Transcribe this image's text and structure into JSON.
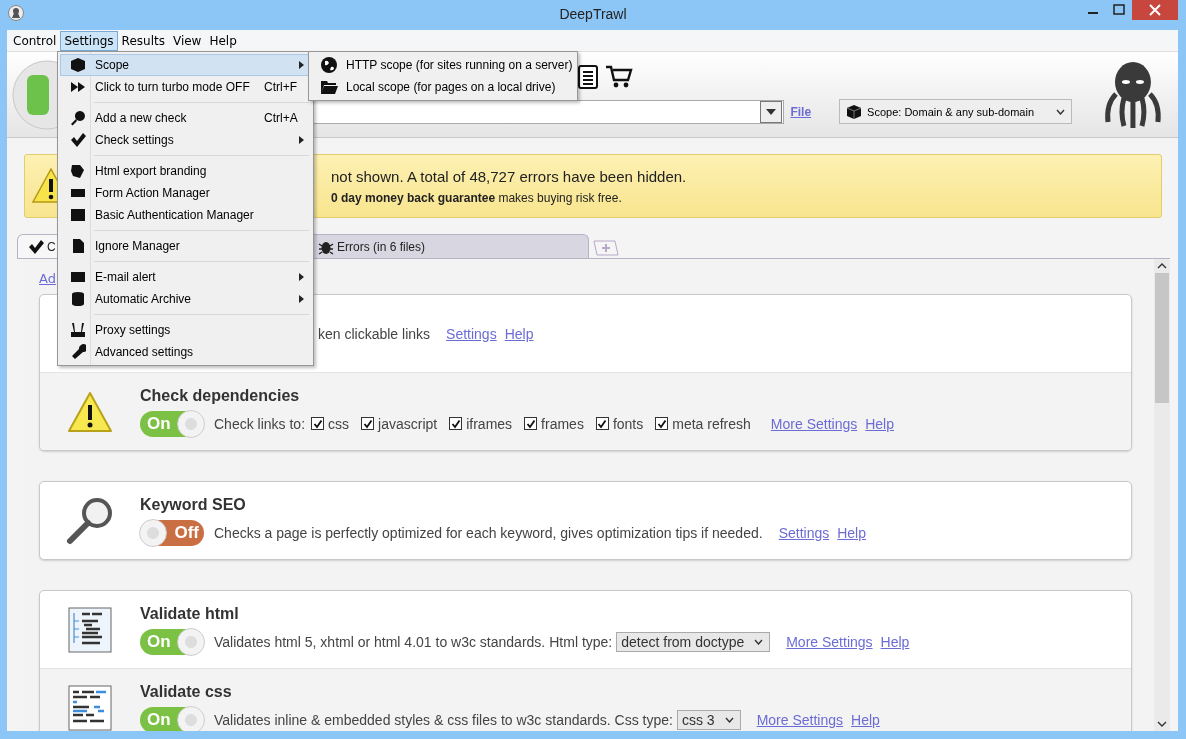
{
  "window": {
    "title": "DeepTrawl"
  },
  "menu_bar": [
    {
      "label": "Control",
      "selected": false
    },
    {
      "label": "Settings",
      "selected": true
    },
    {
      "label": "Results",
      "selected": false
    },
    {
      "label": "View",
      "selected": false
    },
    {
      "label": "Help",
      "selected": false
    }
  ],
  "settings_menu": [
    {
      "kind": "item",
      "label": "Scope",
      "submenu": true,
      "selected": true
    },
    {
      "kind": "item",
      "label": "Click to turn turbo mode OFF",
      "shortcut": "Ctrl+F",
      "submenu": false,
      "selected": false
    },
    {
      "kind": "separator"
    },
    {
      "kind": "item",
      "label": "Add a new check",
      "shortcut": "Ctrl+A",
      "submenu": false,
      "selected": false
    },
    {
      "kind": "item",
      "label": "Check settings",
      "submenu": true,
      "selected": false
    },
    {
      "kind": "separator"
    },
    {
      "kind": "item",
      "label": "Html export branding",
      "submenu": false,
      "selected": false
    },
    {
      "kind": "item",
      "label": "Form Action Manager",
      "submenu": false,
      "selected": false
    },
    {
      "kind": "item",
      "label": "Basic Authentication Manager",
      "submenu": false,
      "selected": false
    },
    {
      "kind": "separator"
    },
    {
      "kind": "item",
      "label": "Ignore Manager",
      "submenu": false,
      "selected": false
    },
    {
      "kind": "separator"
    },
    {
      "kind": "item",
      "label": "E-mail alert",
      "submenu": true,
      "selected": false
    },
    {
      "kind": "item",
      "label": "Automatic Archive",
      "submenu": true,
      "selected": false
    },
    {
      "kind": "separator"
    },
    {
      "kind": "item",
      "label": "Proxy settings",
      "submenu": false,
      "selected": false
    },
    {
      "kind": "item",
      "label": "Advanced settings",
      "submenu": false,
      "selected": false
    }
  ],
  "scope_submenu": [
    {
      "label": "HTTP scope (for sites running on a server)"
    },
    {
      "label": "Local scope (for pages on a local drive)"
    }
  ],
  "toolbar": {
    "file_link": "File",
    "scope_select": "Scope: Domain & any sub-domain"
  },
  "banner": {
    "line_1": "not shown. A total of 48,727 errors have been hidden.",
    "line_2": "**0 day money back guarantee** makes buying risk free."
  },
  "tabs": [
    {
      "kind": "checks",
      "label": "C",
      "selected": true
    },
    {
      "kind": "errors",
      "label": "Errors (in 6 files)",
      "selected": false
    }
  ],
  "add_link": "Ad",
  "cards": [
    {
      "rows": [
        {
          "kind": "partial",
          "description": "ken clickable links",
          "links": [
            "Settings",
            "Help"
          ]
        },
        {
          "kind": "options",
          "title": "Check dependencies",
          "toggle": {
            "on": true,
            "label": "On"
          },
          "description": "Check links to:",
          "options": [
            {
              "label": "css",
              "checked": true
            },
            {
              "label": "javascript",
              "checked": true
            },
            {
              "label": "iframes",
              "checked": true
            },
            {
              "label": "frames",
              "checked": true
            },
            {
              "label": "fonts",
              "checked": true
            },
            {
              "label": "meta refresh",
              "checked": true
            }
          ],
          "links": [
            "More Settings",
            "Help"
          ]
        }
      ]
    },
    {
      "rows": [
        {
          "kind": "plain",
          "title": "Keyword SEO",
          "toggle": {
            "on": false,
            "label": "Off"
          },
          "description": "Checks a page is perfectly optimized for each keyword, gives optimization tips if needed.",
          "links": [
            "Settings",
            "Help"
          ]
        }
      ]
    },
    {
      "rows": [
        {
          "kind": "select",
          "title": "Validate html",
          "toggle": {
            "on": true,
            "label": "On"
          },
          "description": "Validates html 5, xhtml or html 4.01 to w3c standards.",
          "select_label": "Html type:",
          "select_value": "detect from doctype",
          "links": [
            "More Settings",
            "Help"
          ]
        },
        {
          "kind": "select",
          "title": "Validate css",
          "toggle": {
            "on": true,
            "label": "On"
          },
          "description": "Validates inline & embedded styles & css files to w3c standards.",
          "select_label": "Css type:",
          "select_value": "css 3",
          "links": [
            "More Settings",
            "Help"
          ]
        }
      ]
    }
  ]
}
